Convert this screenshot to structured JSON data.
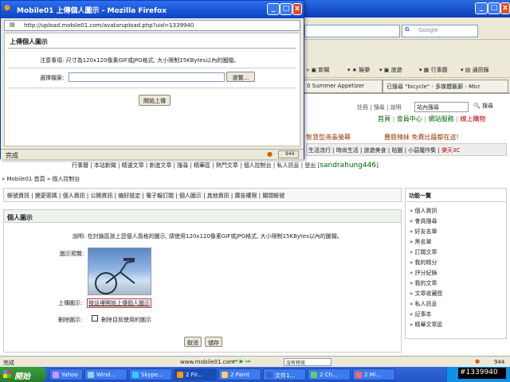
{
  "popup": {
    "title": "Mobile01 上傳個人圖示 - Mozilla Firefox",
    "url": "http://upload.mobile01.com/avatarupload.php?uid=1339940",
    "heading": "上傳個人圖示",
    "note": "注意事項: 尺寸為120x120像素GIF或JPG格式, 大小限制15KBytes以內的圖檔。",
    "file_label": "選擇檔案:",
    "browse_label": "瀏覽...",
    "upload_label": "開始上傳",
    "status": "完成",
    "status_badge": "944"
  },
  "browser": {
    "search_placeholder": "Google",
    "bookmarks": [
      "新聞",
      "娛樂",
      "旅遊",
      "行事曆",
      "通訊錄"
    ],
    "tabs": [
      "0 Summer Appetizer",
      "已搜尋 \"bicycle\" - 多媒體藝廊 - Micr"
    ],
    "status": "完成",
    "status_url": "www.mobile01.com",
    "status_badge": "944",
    "status_box": "沒有特效"
  },
  "site": {
    "top_links": [
      "註冊",
      "搜尋",
      "說明"
    ],
    "search_value": "站內搜尋",
    "search_button": "搜尋",
    "sub_links": [
      "首頁",
      "會員中心",
      "網站服務",
      "線上購物"
    ],
    "ad1": "智慧型液晶螢幕",
    "ad2": "豐唇辣妹 免費比薩都在這!",
    "cat_links": [
      "生活流行",
      "時尚生活",
      "旅遊美食",
      "貼圖",
      "小惡魔作集",
      "樂天3C"
    ],
    "nav_links": [
      "行事曆",
      "本站新聞",
      "精選文章",
      "新進文章",
      "搜尋",
      "精華區",
      "熱門文章",
      "個人控制台",
      "私人訊息",
      "登出"
    ],
    "username": "sandrahung446",
    "breadcrumb": "» Mobile01 首頁 » 個人控制台",
    "tabs": [
      "帳號資訊",
      "變更密碼",
      "個人資訊",
      "公開資訊",
      "偏好設定",
      "電子報訂閱",
      "個人圖示",
      "其他資訊",
      "廣告權限",
      "關閉帳號"
    ],
    "section_title": "個人圖示",
    "description": "說明: 在討論區放上您個人風格的圖示, 請使用120x120像素GIF或JPG格式, 大小限制15KBytes以內的圖檔。",
    "preview_label": "圖示預覽:",
    "upload_label": "上傳圖示:",
    "upload_link": "按這裡開始上傳個人圖示",
    "delete_label": "刪除圖示:",
    "delete_checkbox": "刪除目前使用的圖示",
    "cancel": "取消",
    "save": "儲存",
    "side_title": "功能一覽",
    "side_links": [
      "» 個人資訊",
      "» 會員搜尋",
      "» 好友名單",
      "» 黑名單",
      "» 訂閱文章",
      "» 我的精分",
      "» 評分紀錄",
      "» 我的文章",
      "» 文章收藏匣",
      "» 私人訊息",
      "» 記事本",
      "» 精華文章區"
    ]
  },
  "taskbar": {
    "start": "開始",
    "items": [
      "Yahoo",
      "Wind...",
      "Skype...",
      "2 Fir...",
      "2 Paint",
      "文件1...",
      "2 Ch...",
      "2 Mi..."
    ],
    "watermark": "#1339940"
  }
}
